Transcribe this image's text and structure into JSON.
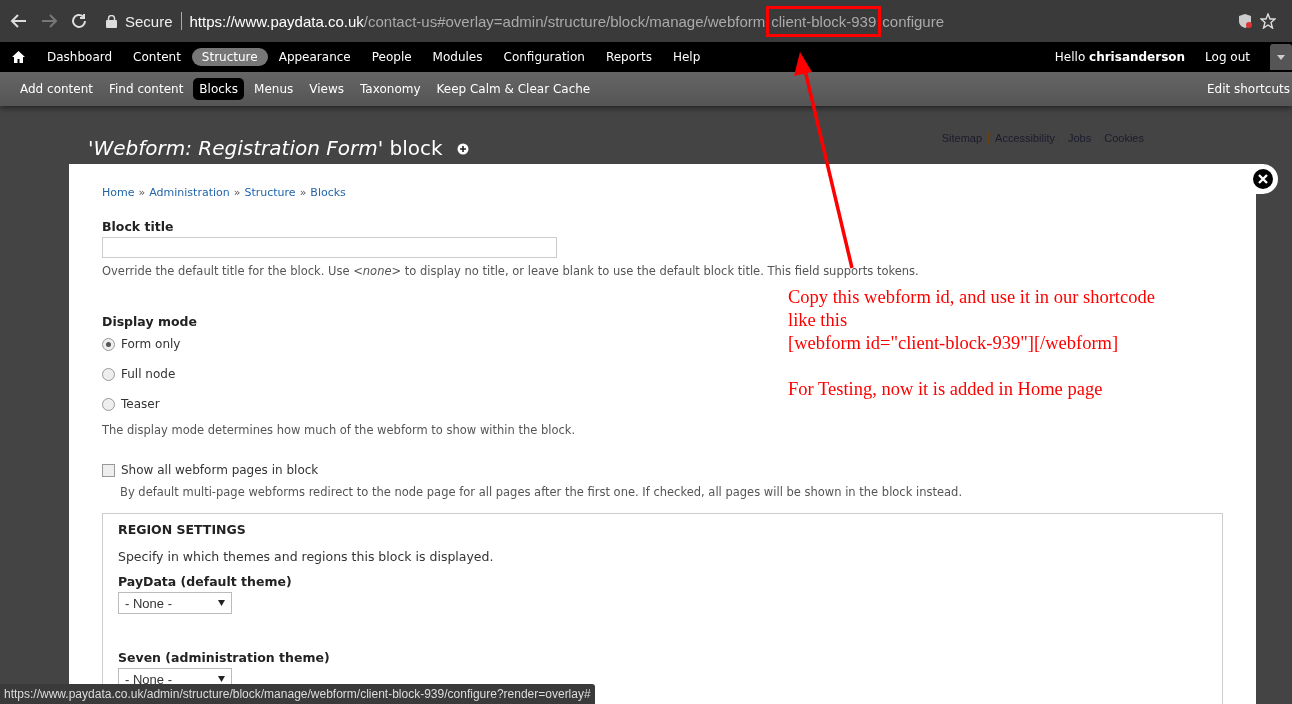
{
  "browser": {
    "secure_label": "Secure",
    "url_host": "https://www.paydata.co.uk",
    "url_path": "/contact-us#overlay=admin/structure/block/manage/webform",
    "url_highlight": "client-block-939",
    "url_rest": "configure",
    "back_disabled": false,
    "forward_disabled": true
  },
  "toolbar": {
    "items": [
      {
        "label": "Dashboard",
        "selected": false
      },
      {
        "label": "Content",
        "selected": false
      },
      {
        "label": "Structure",
        "selected": true
      },
      {
        "label": "Appearance",
        "selected": false
      },
      {
        "label": "People",
        "selected": false
      },
      {
        "label": "Modules",
        "selected": false
      },
      {
        "label": "Configuration",
        "selected": false
      },
      {
        "label": "Reports",
        "selected": false
      },
      {
        "label": "Help",
        "selected": false
      }
    ],
    "greeting": "Hello **chrisanderson**",
    "logout": "Log out"
  },
  "shortcuts": {
    "items": [
      {
        "label": "Add content",
        "selected": false
      },
      {
        "label": "Find content",
        "selected": false
      },
      {
        "label": "Blocks",
        "selected": true
      },
      {
        "label": "Menus",
        "selected": false
      },
      {
        "label": "Views",
        "selected": false
      },
      {
        "label": "Taxonomy",
        "selected": false
      },
      {
        "label": "Keep Calm & Clear Cache",
        "selected": false
      }
    ],
    "edit": "Edit shortcuts"
  },
  "overlay": {
    "title": "'*Webform: Registration Form*' block",
    "footer_links": [
      "Sitemap",
      "Accessibility",
      "Jobs",
      "Cookies"
    ]
  },
  "breadcrumb": [
    "Home",
    "Administration",
    "Structure",
    "Blocks"
  ],
  "breadcrumb_separator": "»",
  "block_title": {
    "label": "Block title",
    "description": "Override the default title for the block. Use *<none>* to display no title, or leave blank to use the default block title. This field supports tokens."
  },
  "display_mode": {
    "label": "Display mode",
    "options": [
      {
        "label": "Form only",
        "selected": true
      },
      {
        "label": "Full node",
        "selected": false
      },
      {
        "label": "Teaser",
        "selected": false
      }
    ],
    "description": "The display mode determines how much of the webform to show within the block."
  },
  "show_all_pages": {
    "label": "Show all webform pages in block",
    "checked": false,
    "description": "By default multi-page webforms redirect to the node page for all pages after the first one. If checked, all pages will be shown in the block instead."
  },
  "region_settings": {
    "legend": "REGION SETTINGS",
    "description": "Specify in which themes and regions this block is displayed.",
    "themes": [
      {
        "label": "PayData (default theme)",
        "value": "- None -"
      },
      {
        "label": "Seven (administration theme)",
        "value": "- None -"
      }
    ]
  },
  "annotation": {
    "paragraphs": [
      [
        "Copy this webform id, and use it in our shortcode",
        "like this",
        "[webform id=\"client-block-939\"][/webform]"
      ],
      [
        "For Testing, now it is added in Home page"
      ]
    ]
  },
  "status_url": "https://www.paydata.co.uk/admin/structure/block/manage/webform/client-block-939/configure?render=overlay#"
}
